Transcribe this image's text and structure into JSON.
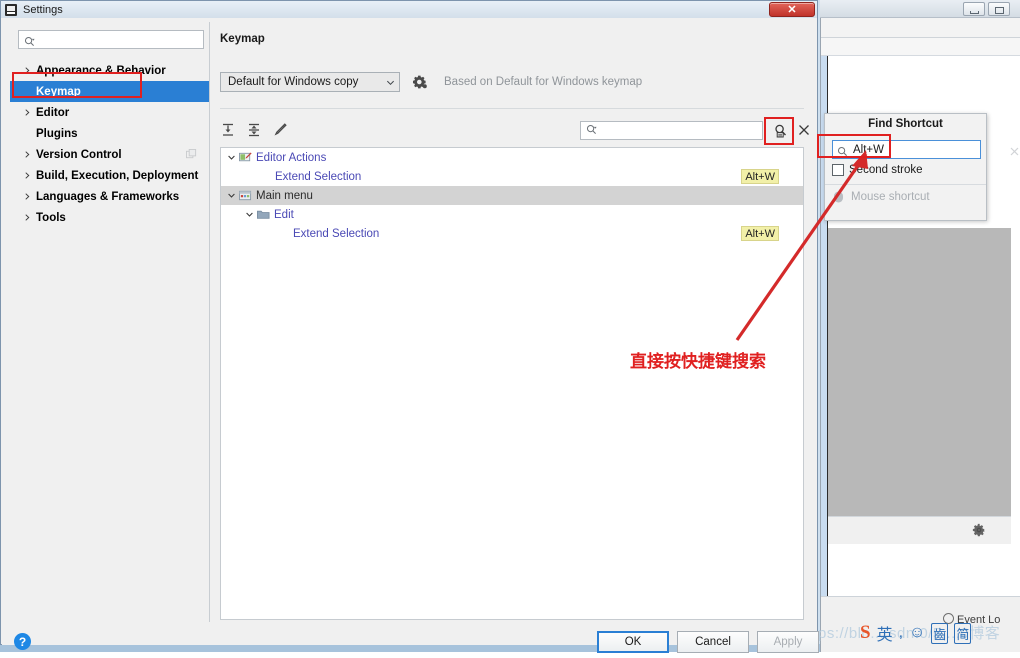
{
  "window": {
    "title": "Settings",
    "icon": "intellij-icon",
    "close_label": "✕"
  },
  "background_window": {
    "minimize_label": "minimize-icon",
    "maximize_label": "maximize-icon",
    "event_log_label": "Event Lo",
    "gear_icon": "gear-icon",
    "watermark": "ps://blo....sdn.0/5....0博客",
    "ime": {
      "logo": "S",
      "mode_label": "英",
      "punct_label": ",",
      "emoji_label": "☺",
      "shape_label": "齒",
      "simplified_label": "简"
    }
  },
  "sidebar": {
    "search": {
      "value": "",
      "placeholder": "",
      "icon": "search-icon"
    },
    "items": [
      {
        "label": "Appearance & Behavior",
        "has_chevron": true,
        "selected": false,
        "trailing_icon": ""
      },
      {
        "label": "Keymap",
        "has_chevron": false,
        "selected": true,
        "trailing_icon": ""
      },
      {
        "label": "Editor",
        "has_chevron": true,
        "selected": false,
        "trailing_icon": ""
      },
      {
        "label": "Plugins",
        "has_chevron": false,
        "selected": false,
        "trailing_icon": ""
      },
      {
        "label": "Version Control",
        "has_chevron": true,
        "selected": false,
        "trailing_icon": "copy-icon"
      },
      {
        "label": "Build, Execution, Deployment",
        "has_chevron": true,
        "selected": false,
        "trailing_icon": ""
      },
      {
        "label": "Languages & Frameworks",
        "has_chevron": true,
        "selected": false,
        "trailing_icon": ""
      },
      {
        "label": "Tools",
        "has_chevron": true,
        "selected": false,
        "trailing_icon": ""
      }
    ],
    "help_label": "?"
  },
  "pane": {
    "title": "Keymap",
    "keymap_combo": {
      "value": "Default for Windows copy",
      "arrow_icon": "chevron-down-icon"
    },
    "gear_icon": "gear-settings-icon",
    "based_on": "Based on Default for Windows keymap",
    "toolbar": {
      "expand_all_icon": "expand-all-icon",
      "collapse_all_icon": "collapse-all-icon",
      "edit_icon": "pencil-edit-icon"
    },
    "tree_search": {
      "value": "",
      "placeholder": "",
      "icon": "search-icon"
    },
    "find_shortcut_icon": "find-shortcut-icon",
    "close_search_icon": "close-icon",
    "tree": [
      {
        "label": "Editor Actions",
        "depth": 0,
        "chevron": "down",
        "icon": "editor-actions-icon",
        "selected": false,
        "plain": false,
        "badge": ""
      },
      {
        "label": "Extend Selection",
        "depth": 2,
        "chevron": "",
        "icon": "",
        "selected": false,
        "plain": false,
        "badge": "Alt+W"
      },
      {
        "label": "Main menu",
        "depth": 0,
        "chevron": "down",
        "icon": "main-menu-icon",
        "selected": true,
        "plain": true,
        "badge": ""
      },
      {
        "label": "Edit",
        "depth": 1,
        "chevron": "down",
        "icon": "folder-icon",
        "selected": false,
        "plain": false,
        "badge": ""
      },
      {
        "label": "Extend Selection",
        "depth": 3,
        "chevron": "",
        "icon": "",
        "selected": false,
        "plain": false,
        "badge": "Alt+W"
      }
    ]
  },
  "buttons": {
    "ok": "OK",
    "cancel": "Cancel",
    "apply": "Apply"
  },
  "find_shortcut_popup": {
    "title": "Find Shortcut",
    "input": {
      "value": "Alt+W",
      "placeholder": "",
      "icon": "search-icon",
      "clear_icon": "clear-icon"
    },
    "second_stroke_label": "Second stroke",
    "second_stroke_checked": false,
    "mouse_shortcut_label": "Mouse shortcut",
    "mouse_shortcut_icon": "mouse-icon"
  },
  "annotations": {
    "note_text": "直接按快捷键搜索",
    "highlight_color": "#e02020",
    "arrow_color": "#d42a2a"
  },
  "colors": {
    "selection_blue": "#2a7fd4",
    "badge_yellow": "#f2f0a8",
    "tree_link": "#4a49b5",
    "disabled_gray": "#a9aeb3",
    "popup_border_focus": "#4a90d9"
  }
}
